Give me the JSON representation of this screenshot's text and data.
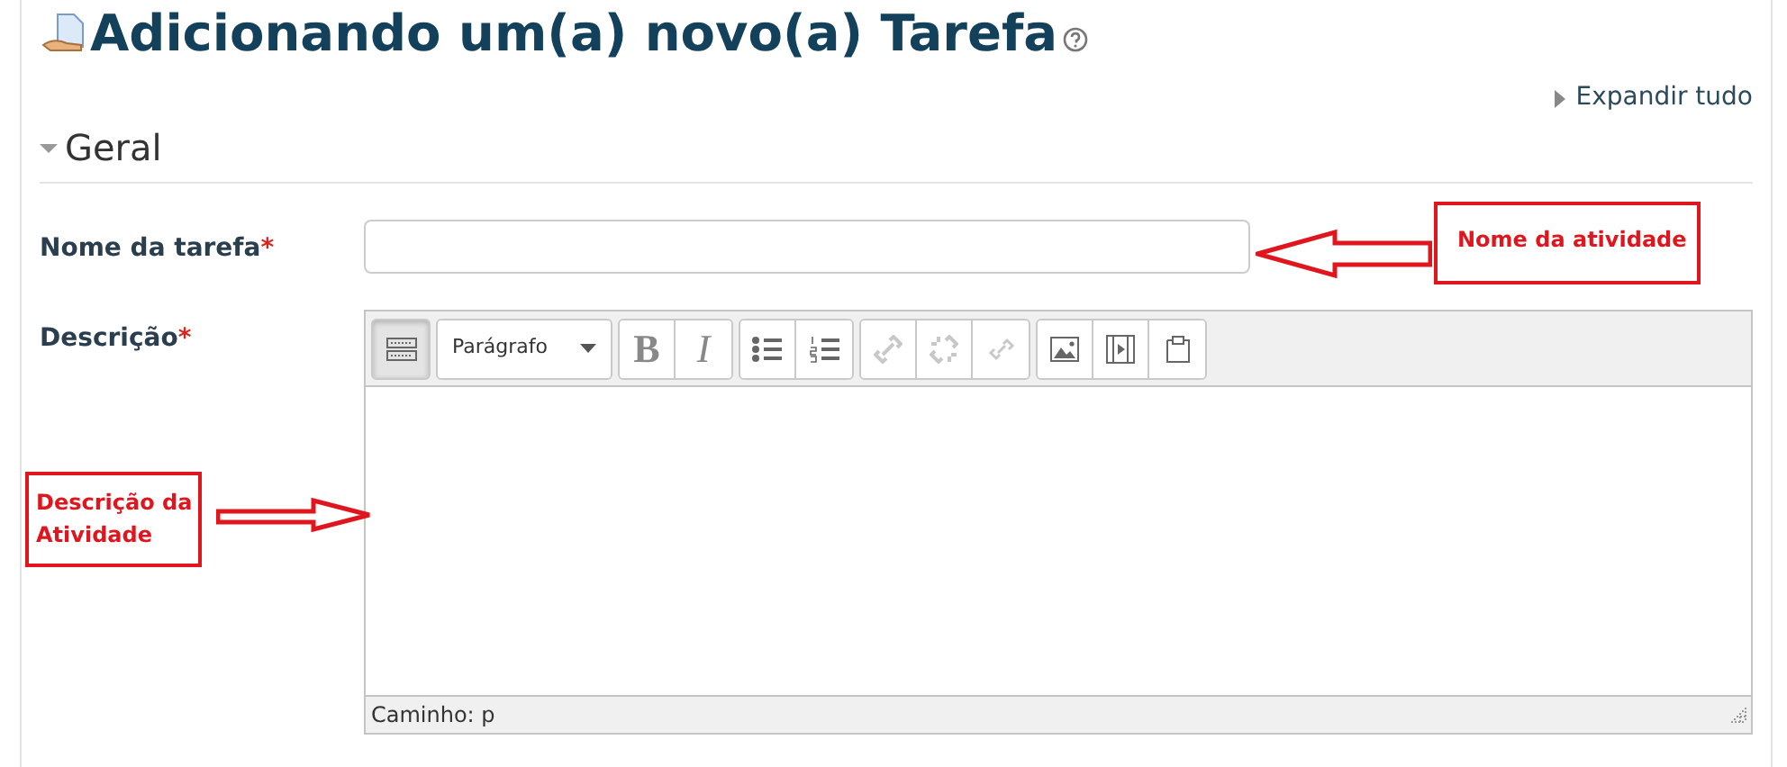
{
  "page": {
    "title": "Adicionando um(a) novo(a) Tarefa",
    "expand_all": "Expandir tudo"
  },
  "section": {
    "title": "Geral",
    "expanded": true
  },
  "fields": [
    {
      "label": "Nome da tarefa",
      "mark": "*",
      "kind": "text"
    },
    {
      "label": "Descrição",
      "mark": "*",
      "kind": "editor"
    }
  ],
  "editor": {
    "toolbar": [
      [
        {
          "kind": "toggle",
          "selected": true,
          "disabled": false
        }
      ],
      [
        {
          "kind": "select",
          "value": "Parágrafo",
          "disabled": false
        }
      ],
      [
        {
          "kind": "bold",
          "label": "B",
          "disabled": false
        },
        {
          "kind": "italic",
          "label": "I",
          "disabled": false
        }
      ],
      [
        {
          "kind": "bullets",
          "disabled": false
        },
        {
          "kind": "numbers",
          "disabled": false
        }
      ],
      [
        {
          "kind": "link",
          "disabled": true
        },
        {
          "kind": "unlink",
          "disabled": true
        },
        {
          "kind": "anchor",
          "disabled": true
        }
      ],
      [
        {
          "kind": "image",
          "disabled": false
        },
        {
          "kind": "media",
          "disabled": false
        },
        {
          "kind": "paste",
          "disabled": false
        }
      ]
    ],
    "path": "Caminho: p"
  },
  "annotations": [
    {
      "text": "Nome da atividade",
      "kind": "left"
    },
    {
      "text": "Descrição da Atividade",
      "kind": "right"
    }
  ]
}
